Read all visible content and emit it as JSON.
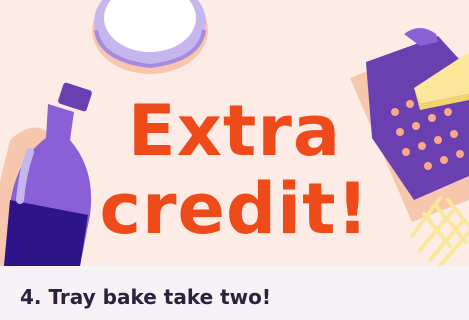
{
  "hero": {
    "headline_line1": "Extra",
    "headline_line2": "credit!",
    "illustrations": [
      "measuring-jug-icon",
      "bottle-icon",
      "cheese-grater-icon",
      "cheese-icon",
      "grated-cheese-icon"
    ],
    "colors": {
      "background": "#fdece6",
      "headline": "#ee4a1a",
      "purple": "#6a3fb0",
      "dark_purple": "#2d1488",
      "light_purple": "#c6b6ee",
      "peach": "#f6c7ad",
      "cheese": "#fbe79a"
    }
  },
  "caption": {
    "title": "4. Tray bake take two!",
    "background": "#f5f3f6",
    "text_color": "#2a2340"
  }
}
